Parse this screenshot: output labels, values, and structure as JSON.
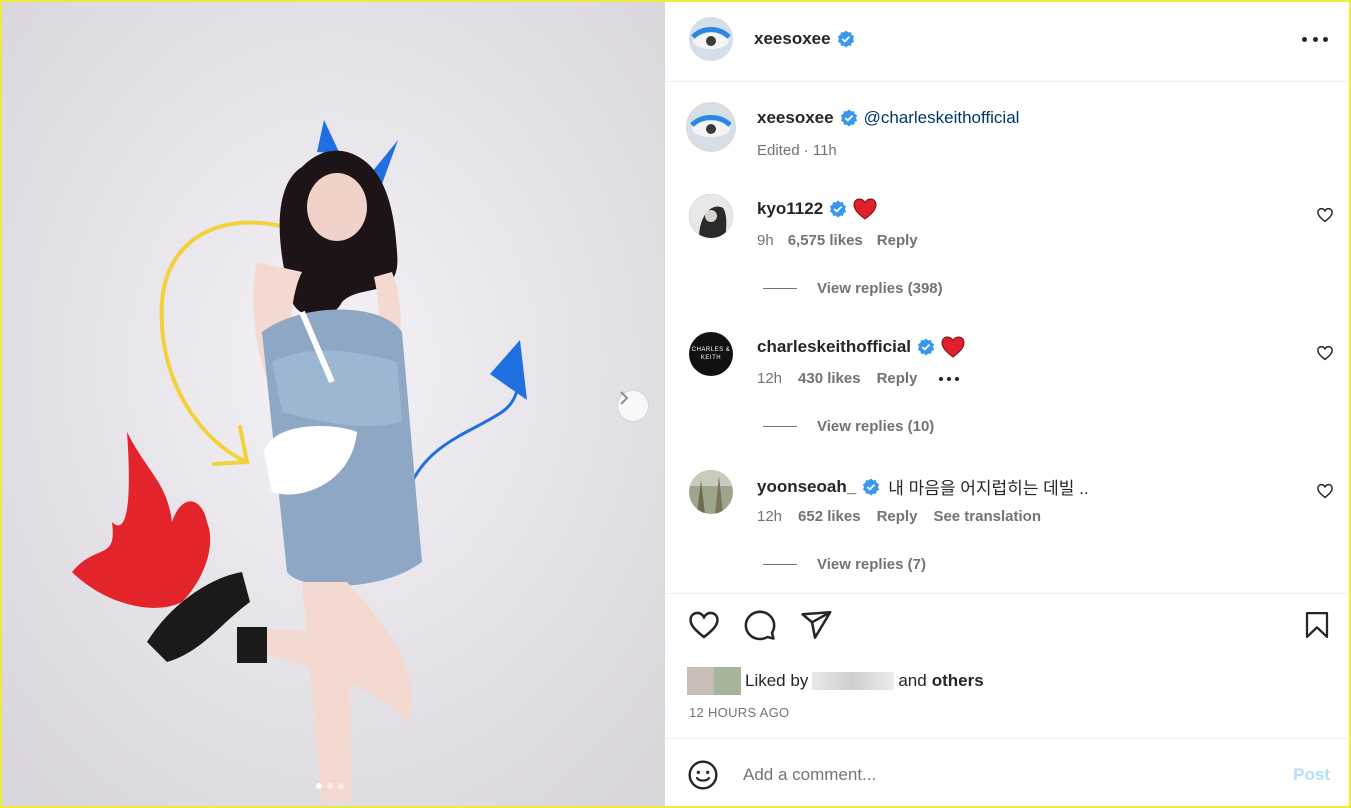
{
  "post": {
    "author": "xeesoxee",
    "image_count": 3,
    "active_image": 1
  },
  "header": {
    "username": "xeesoxee"
  },
  "caption": {
    "username": "xeesoxee",
    "mention": "@charleskeithofficial",
    "meta": "Edited · 11h"
  },
  "comments": [
    {
      "username": "kyo1122",
      "text": "",
      "time": "9h",
      "likes": "6,575 likes",
      "reply": "Reply",
      "view_replies": "View replies (398)",
      "has_heart_emoji": true
    },
    {
      "username": "charleskeithofficial",
      "text": "",
      "time": "12h",
      "likes": "430 likes",
      "reply": "Reply",
      "view_replies": "View replies (10)",
      "has_heart_emoji": true,
      "avatar_text": "CHARLES & KEITH"
    },
    {
      "username": "yoonseoah_",
      "text": "내 마음을 어지럽히는 데빌 ..",
      "time": "12h",
      "likes": "652 likes",
      "reply": "Reply",
      "translation": "See translation",
      "view_replies": "View replies (7)",
      "has_heart_emoji": false
    }
  ],
  "liked_by": {
    "prefix": "Liked by",
    "conjunction": "and",
    "others": "others"
  },
  "timestamp": "12 HOURS AGO",
  "comment_box": {
    "placeholder": "Add a comment...",
    "post_label": "Post"
  },
  "colors": {
    "verified": "#3897f0",
    "heart_emoji": "#e0202a",
    "post_disabled": "#b2dffc",
    "border": "#f2ea3a"
  }
}
